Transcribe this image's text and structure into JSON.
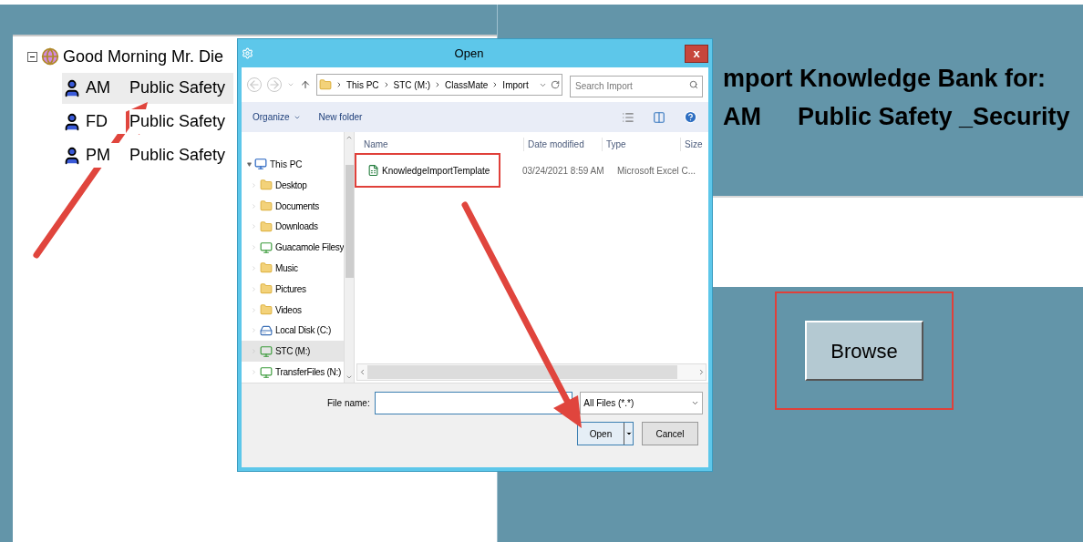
{
  "tree": {
    "root": {
      "label": "Good Morning Mr. Die",
      "expanded": true
    },
    "children": [
      {
        "code": "AM",
        "label": "Public Safety",
        "selected": true
      },
      {
        "code": "FD",
        "label": "Public Safety",
        "selected": false
      },
      {
        "code": "PM",
        "label": "Public Safety",
        "selected": false
      }
    ]
  },
  "import_panel": {
    "heading": "mport Knowledge Bank for:",
    "code": "AM",
    "subject": "Public Safety _Security",
    "browse_button": "Browse"
  },
  "dialog": {
    "title": "Open",
    "close": "x",
    "address": [
      "This PC",
      "STC (M:)",
      "ClassMate",
      "Import"
    ],
    "search": {
      "placeholder": "Search Import"
    },
    "toolbar": [
      "Organize",
      "New folder"
    ],
    "nav": {
      "root": {
        "label": "This PC",
        "expanded": true
      },
      "items": [
        {
          "label": "Desktop",
          "kind": "folder",
          "selected": false
        },
        {
          "label": "Documents",
          "kind": "folder",
          "selected": false
        },
        {
          "label": "Downloads",
          "kind": "folder",
          "selected": false
        },
        {
          "label": "Guacamole Filesy",
          "kind": "network",
          "selected": false
        },
        {
          "label": "Music",
          "kind": "folder",
          "selected": false
        },
        {
          "label": "Pictures",
          "kind": "folder",
          "selected": false
        },
        {
          "label": "Videos",
          "kind": "folder",
          "selected": false
        },
        {
          "label": "Local Disk (C:)",
          "kind": "drive",
          "selected": false
        },
        {
          "label": "STC (M:)",
          "kind": "network",
          "selected": true
        },
        {
          "label": "TransferFiles (N:)",
          "kind": "network",
          "selected": false
        }
      ]
    },
    "columns": [
      "Name",
      "Date modified",
      "Type",
      "Size"
    ],
    "files": [
      {
        "name": "KnowledgeImportTemplate",
        "date": "03/24/2021 8:59 AM",
        "type": "Microsoft Excel C..."
      }
    ],
    "file_name_label": "File name:",
    "filter": "All Files (*.*)",
    "buttons": [
      "Open",
      "Cancel"
    ]
  }
}
